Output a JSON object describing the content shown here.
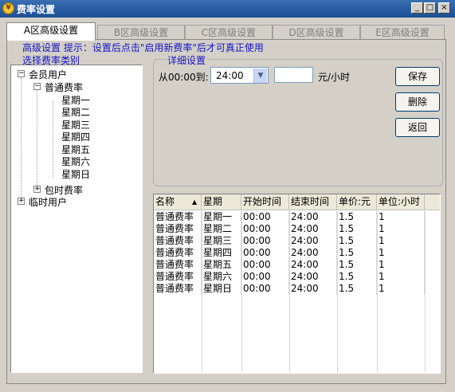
{
  "window": {
    "title": "费率设置",
    "app_icon_glyph": "¥",
    "min_glyph": "_",
    "max_glyph": "□",
    "close_glyph": "×"
  },
  "tabs": [
    {
      "label": "A区高级设置",
      "active": true
    },
    {
      "label": "B区高级设置",
      "active": false
    },
    {
      "label": "C区高级设置",
      "active": false
    },
    {
      "label": "D区高级设置",
      "active": false
    },
    {
      "label": "E区高级设置",
      "active": false
    }
  ],
  "hint": {
    "text": "高级设置  提示：设置后点击\"启用新费率\"后才可真正使用"
  },
  "category_label": "选择费率类别",
  "tree": {
    "member": {
      "label": "会员用户",
      "expander": "−"
    },
    "normal": {
      "label": "普通费率",
      "expander": "−"
    },
    "days": [
      "星期一",
      "星期二",
      "星期三",
      "星期四",
      "星期五",
      "星期六",
      "星期日"
    ],
    "hourly": {
      "label": "包时费率",
      "expander": "+"
    },
    "temp": {
      "label": "临时用户",
      "expander": "+"
    }
  },
  "detail": {
    "legend": "详细设置",
    "from_label": "从00:00到:",
    "end_time": "24:00",
    "price_value": "",
    "unit_label": "元/小时",
    "dropdown_glyph": "▼"
  },
  "buttons": {
    "save": "保存",
    "delete": "删除",
    "back": "返回"
  },
  "grid": {
    "columns": [
      "名称",
      "星期",
      "开始时间",
      "结束时间",
      "单价:元",
      "单位:小时"
    ],
    "sort_glyph": "▲",
    "rows": [
      [
        "普通费率",
        "星期一",
        "00:00",
        "24:00",
        "1.5",
        "1"
      ],
      [
        "普通费率",
        "星期二",
        "00:00",
        "24:00",
        "1.5",
        "1"
      ],
      [
        "普通费率",
        "星期三",
        "00:00",
        "24:00",
        "1.5",
        "1"
      ],
      [
        "普通费率",
        "星期四",
        "00:00",
        "24:00",
        "1.5",
        "1"
      ],
      [
        "普通费率",
        "星期五",
        "00:00",
        "24:00",
        "1.5",
        "1"
      ],
      [
        "普通费率",
        "星期六",
        "00:00",
        "24:00",
        "1.5",
        "1"
      ],
      [
        "普通费率",
        "星期日",
        "00:00",
        "24:00",
        "1.5",
        "1"
      ]
    ]
  }
}
